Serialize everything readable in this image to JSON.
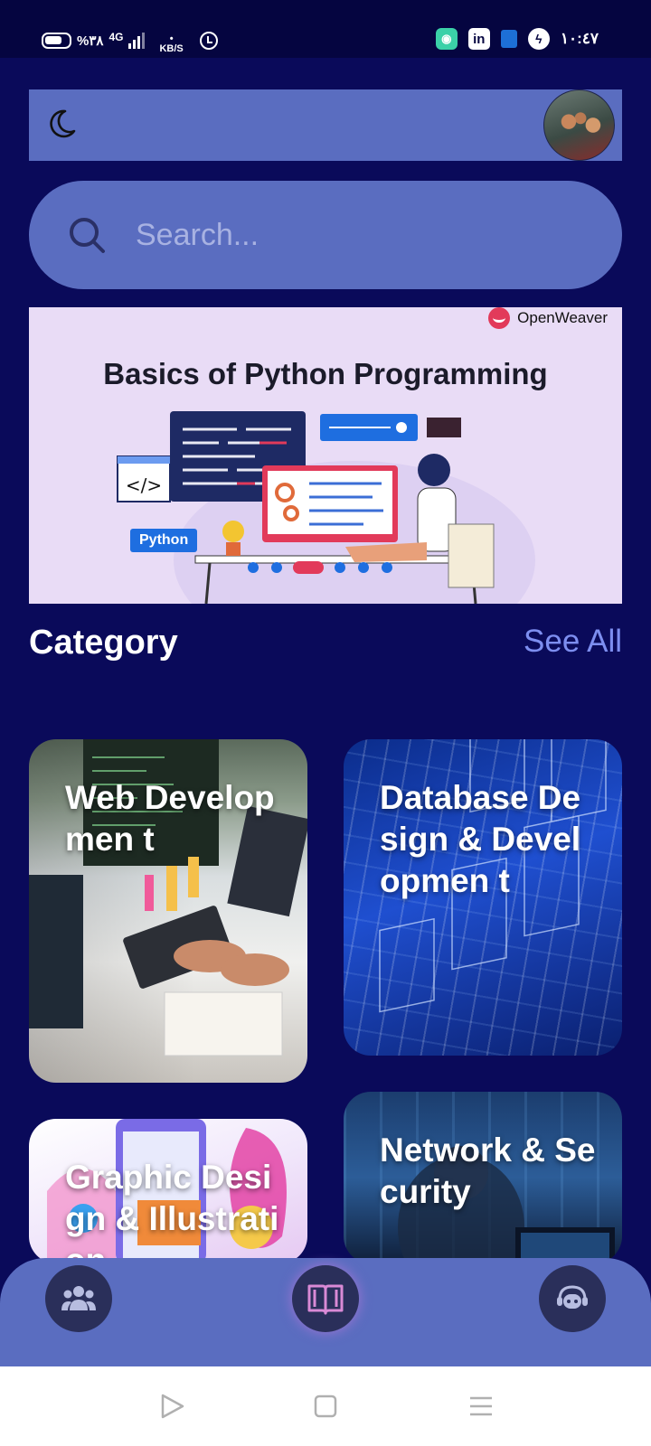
{
  "status_bar": {
    "battery": "%٣٨",
    "network": "4G",
    "speed_unit": "KB/S",
    "time": "١٠:٤٧"
  },
  "header": {
    "theme_toggle": "moon-icon",
    "avatar": "user-avatar"
  },
  "search": {
    "placeholder": "Search..."
  },
  "banner": {
    "brand": "OpenWeaver",
    "title": "Basics of Python Programming",
    "badge": "Python",
    "code_tag": "</>"
  },
  "category": {
    "title": "Category",
    "see_all": "See All",
    "cards": [
      {
        "label": "Web Developmen t"
      },
      {
        "label": "Database Design & Developmen t"
      },
      {
        "label": "Graphic Design & Illustration"
      },
      {
        "label": "Network & Security"
      }
    ]
  },
  "bottom_nav": {
    "items": [
      "community-icon",
      "library-icon",
      "assistant-icon"
    ]
  },
  "system_nav": {
    "items": [
      "back-icon",
      "home-icon",
      "menu-icon"
    ]
  }
}
